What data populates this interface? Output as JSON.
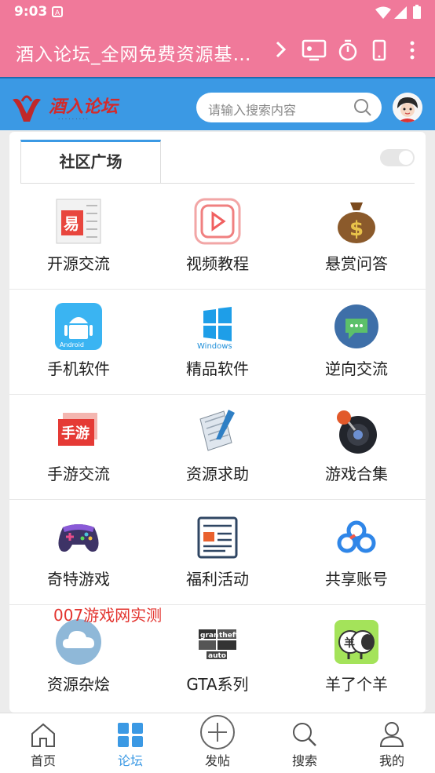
{
  "status_bar": {
    "time": "9:03"
  },
  "app_bar": {
    "title": "酒入论坛_全网免费资源基…"
  },
  "search": {
    "placeholder": "请输入搜索内容"
  },
  "section": {
    "tab_label": "社区广场"
  },
  "grid": [
    [
      "开源交流",
      "视频教程",
      "悬赏问答"
    ],
    [
      "手机软件",
      "精品软件",
      "逆向交流"
    ],
    [
      "手游交流",
      "资源求助",
      "游戏合集"
    ],
    [
      "奇特游戏",
      "福利活动",
      "共享账号"
    ],
    [
      "资源杂烩",
      "GTA系列",
      "羊了个羊"
    ]
  ],
  "icons": [
    [
      "easy-logo-icon",
      "video-play-icon",
      "money-bag-icon"
    ],
    [
      "android-icon",
      "windows-icon",
      "chat-bubble-icon"
    ],
    [
      "mobile-game-icon",
      "document-pen-icon",
      "game-ball-icon"
    ],
    [
      "gamepad-icon",
      "newspaper-icon",
      "share-cloud-icon"
    ],
    [
      "cloud-icon",
      "gta-logo-icon",
      "sheep-icon"
    ]
  ],
  "watermark": "007游戏网实测",
  "bottom_nav": {
    "home": "首页",
    "forum": "论坛",
    "post": "发帖",
    "search": "搜索",
    "mine": "我的"
  },
  "colors": {
    "status_bar": "#f0799a",
    "header": "#3b99e4",
    "active_tab": "#3b99e4",
    "watermark": "#e3342f"
  }
}
